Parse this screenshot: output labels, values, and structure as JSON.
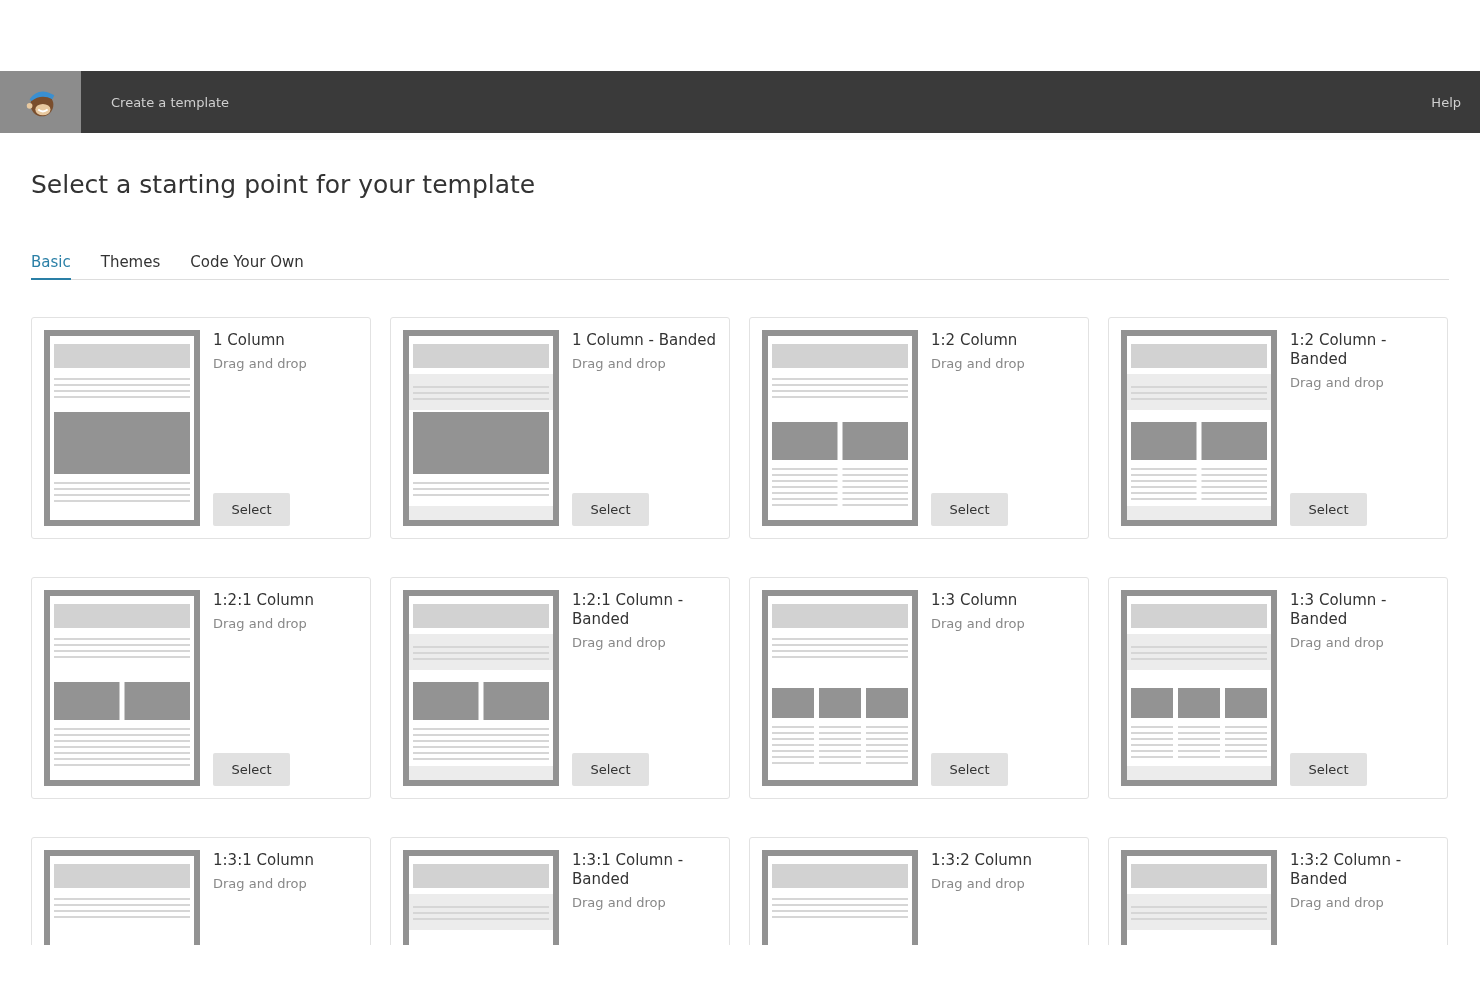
{
  "header": {
    "title": "Create a template",
    "help": "Help"
  },
  "page_title": "Select a starting point for your template",
  "tabs": [
    {
      "label": "Basic",
      "selected": true
    },
    {
      "label": "Themes",
      "selected": false
    },
    {
      "label": "Code Your Own",
      "selected": false
    }
  ],
  "templates": [
    {
      "title": "1 Column",
      "subtitle": "Drag and drop",
      "button": "Select",
      "kind": "one",
      "banded": false
    },
    {
      "title": "1 Column - Banded",
      "subtitle": "Drag and drop",
      "button": "Select",
      "kind": "one",
      "banded": true
    },
    {
      "title": "1:2 Column",
      "subtitle": "Drag and drop",
      "button": "Select",
      "kind": "one-two",
      "banded": false
    },
    {
      "title": "1:2 Column - Banded",
      "subtitle": "Drag and drop",
      "button": "Select",
      "kind": "one-two",
      "banded": true
    },
    {
      "title": "1:2:1 Column",
      "subtitle": "Drag and drop",
      "button": "Select",
      "kind": "one-two-one",
      "banded": false
    },
    {
      "title": "1:2:1 Column - Banded",
      "subtitle": "Drag and drop",
      "button": "Select",
      "kind": "one-two-one",
      "banded": true
    },
    {
      "title": "1:3 Column",
      "subtitle": "Drag and drop",
      "button": "Select",
      "kind": "one-three",
      "banded": false
    },
    {
      "title": "1:3 Column - Banded",
      "subtitle": "Drag and drop",
      "button": "Select",
      "kind": "one-three",
      "banded": true
    },
    {
      "title": "1:3:1 Column",
      "subtitle": "Drag and drop",
      "kind": "one-three-one",
      "banded": false
    },
    {
      "title": "1:3:1 Column - Banded",
      "subtitle": "Drag and drop",
      "kind": "one-three-one",
      "banded": true
    },
    {
      "title": "1:3:2 Column",
      "subtitle": "Drag and drop",
      "kind": "one-three-two",
      "banded": false
    },
    {
      "title": "1:3:2 Column - Banded",
      "subtitle": "Drag and drop",
      "kind": "one-three-two",
      "banded": true
    }
  ]
}
